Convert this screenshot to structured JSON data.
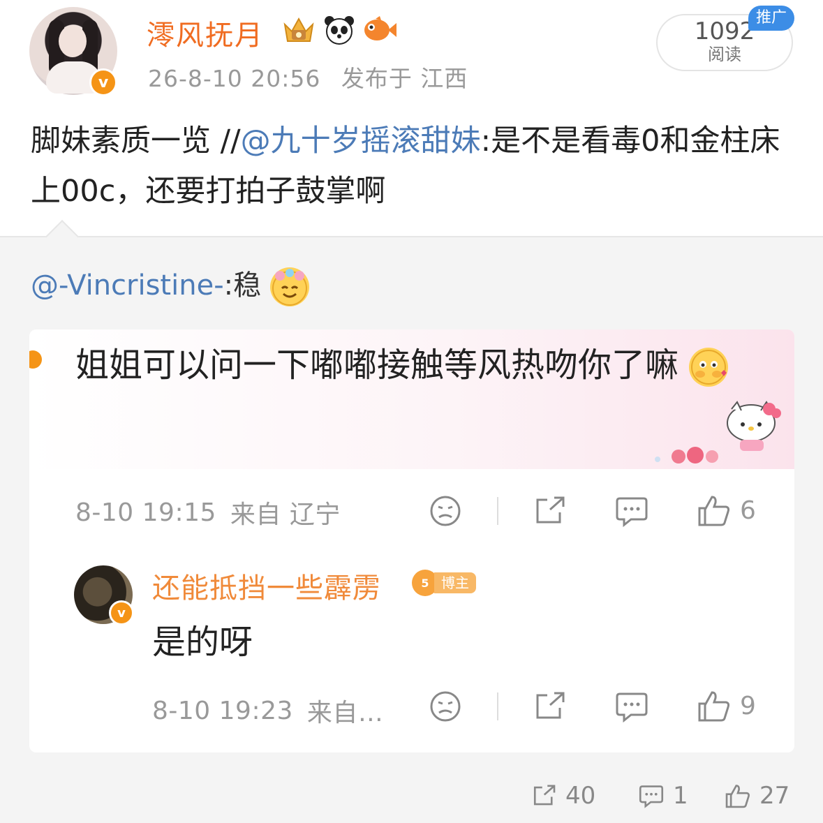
{
  "header": {
    "username": "澪风抚月",
    "timestamp": "26-8-10 20:56",
    "location_label": "发布于 江西",
    "read_count": "1092",
    "read_label": "阅读",
    "promo_tag": "推广",
    "badges": [
      "crown-badge-icon",
      "panda-badge-icon",
      "fish-badge-icon"
    ]
  },
  "post": {
    "text_before": "脚妹素质一览 //",
    "mention": "@九十岁摇滚甜妹",
    "text_after": ":是不是看毒0和金柱床上00c，还要打拍子鼓掌啊"
  },
  "repost": {
    "mention": "@-Vincristine-",
    "text": ":稳"
  },
  "comment": {
    "text": "姐姐可以问一下嘟嘟接触等风热吻你了嘛",
    "time": "8-10 19:15",
    "location": "来自 辽宁",
    "likes": "6"
  },
  "reply": {
    "name": "还能抵挡一些霹雳",
    "host_level": "5",
    "host_label": "博主",
    "text": "是的呀",
    "time": "8-10 19:23",
    "location": "来自…",
    "likes": "9"
  },
  "footer": {
    "reposts": "40",
    "comments": "1",
    "likes": "27"
  },
  "colors": {
    "username": "#f06c21",
    "mention": "#4c7bb7",
    "verify": "#f59416",
    "promo": "#3c8de6"
  }
}
